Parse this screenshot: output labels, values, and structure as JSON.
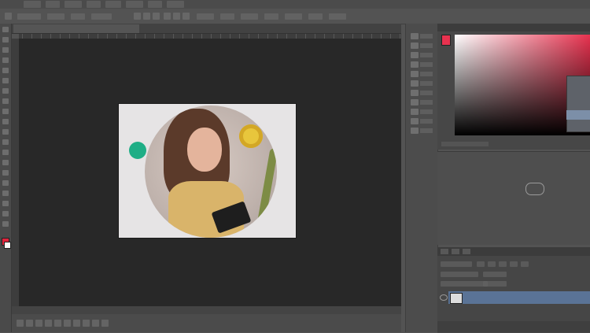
{
  "app": {
    "title": "",
    "accent": "#5a7396",
    "foreground_color": "#e0243c",
    "background_color": "#fafafa"
  },
  "menubar": {
    "items": [
      "",
      "",
      "",
      "",
      "",
      "",
      "",
      ""
    ]
  },
  "toolbox": {
    "tools": [
      "move-icon",
      "marquee-icon",
      "lasso-icon",
      "quick-select-icon",
      "crop-icon",
      "eyedropper-icon",
      "healing-icon",
      "brush-icon",
      "clone-stamp-icon",
      "history-brush-icon",
      "eraser-icon",
      "gradient-icon",
      "blur-icon",
      "dodge-icon",
      "pen-icon",
      "type-icon",
      "path-select-icon",
      "shape-icon",
      "hand-icon",
      "zoom-icon"
    ]
  },
  "document": {
    "tab_label": "",
    "status_text": ""
  },
  "panels": {
    "color": {
      "active_hue": "#e8324f"
    },
    "library": {
      "message": "",
      "action": ""
    },
    "layers": {
      "layer_name": "",
      "blend_mode": "",
      "opacity": ""
    }
  }
}
